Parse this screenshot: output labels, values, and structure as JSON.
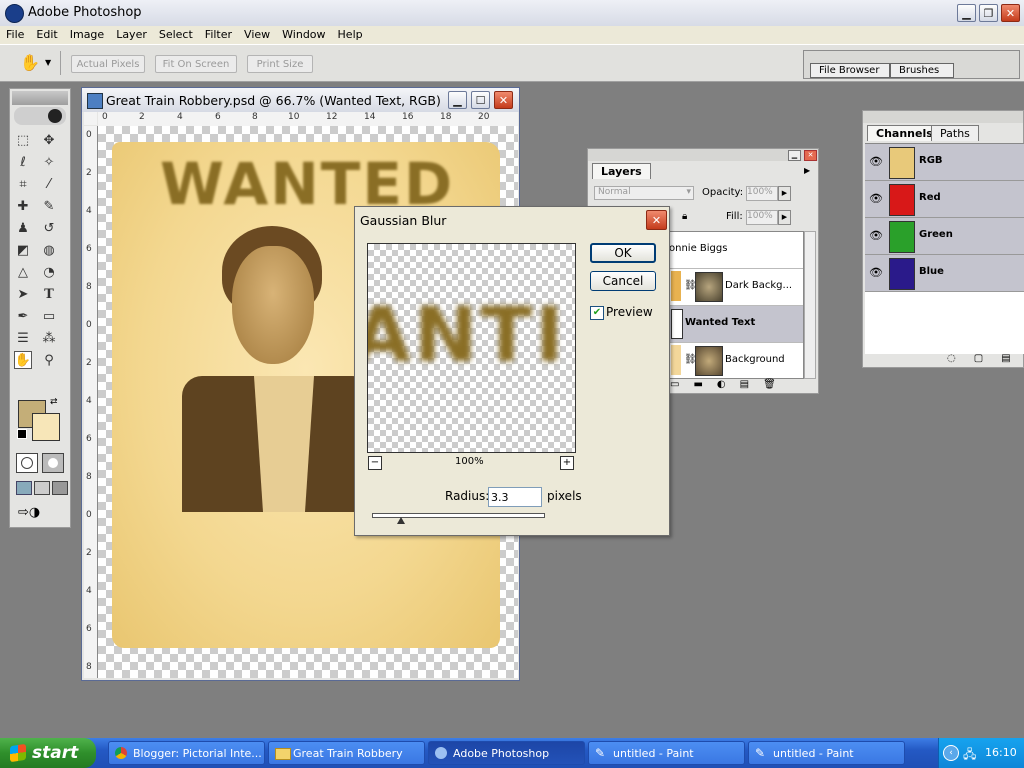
{
  "app": {
    "title": "Adobe Photoshop"
  },
  "menu": [
    "File",
    "Edit",
    "Image",
    "Layer",
    "Select",
    "Filter",
    "View",
    "Window",
    "Help"
  ],
  "options": {
    "actual_pixels": "Actual Pixels",
    "fit_on_screen": "Fit On Screen",
    "print_size": "Print Size"
  },
  "palette_well": {
    "tabs": [
      "File Browser",
      "Brushes"
    ]
  },
  "document": {
    "title": "Great Train Robbery.psd @ 66.7% (Wanted Text, RGB)",
    "poster_text": "WANTED",
    "ruler_top": [
      "0",
      "2",
      "4",
      "6",
      "8",
      "10",
      "12",
      "14",
      "16",
      "18",
      "20"
    ],
    "ruler_left": [
      "0",
      "2",
      "4",
      "6",
      "8",
      "0",
      "2",
      "4",
      "6",
      "8",
      "0",
      "2",
      "4",
      "6",
      "8"
    ]
  },
  "layers_panel": {
    "tab": "Layers",
    "blend_mode": "Normal",
    "opacity_label": "Opacity:",
    "opacity_value": "100%",
    "fill_label": "Fill:",
    "fill_value": "100%",
    "layers": [
      {
        "name": "onnie Biggs"
      },
      {
        "name": "Dark Backg..."
      },
      {
        "name": "Wanted Text"
      },
      {
        "name": "Background"
      }
    ]
  },
  "channels_panel": {
    "tabs": [
      "Channels",
      "Paths"
    ],
    "channels": [
      {
        "name": "RGB",
        "color": "#e8c97a"
      },
      {
        "name": "Red",
        "color": "#d81818"
      },
      {
        "name": "Green",
        "color": "#2aa02a"
      },
      {
        "name": "Blue",
        "color": "#2a1a8a"
      }
    ]
  },
  "dialog": {
    "title": "Gaussian Blur",
    "ok": "OK",
    "cancel": "Cancel",
    "preview_label": "Preview",
    "preview_checked": true,
    "preview_text": "ANTI",
    "zoom": "100%",
    "radius_label": "Radius:",
    "radius_value": "3.3",
    "radius_unit": "pixels"
  },
  "taskbar": {
    "start": "start",
    "tasks": [
      "Blogger: Pictorial Inte...",
      "Great Train Robbery",
      "Adobe Photoshop",
      "untitled - Paint",
      "untitled - Paint"
    ],
    "clock": "16:10"
  },
  "colors": {
    "foreground": "#c4ae78",
    "background": "#f7e6b8",
    "accent": "#2459c4"
  }
}
